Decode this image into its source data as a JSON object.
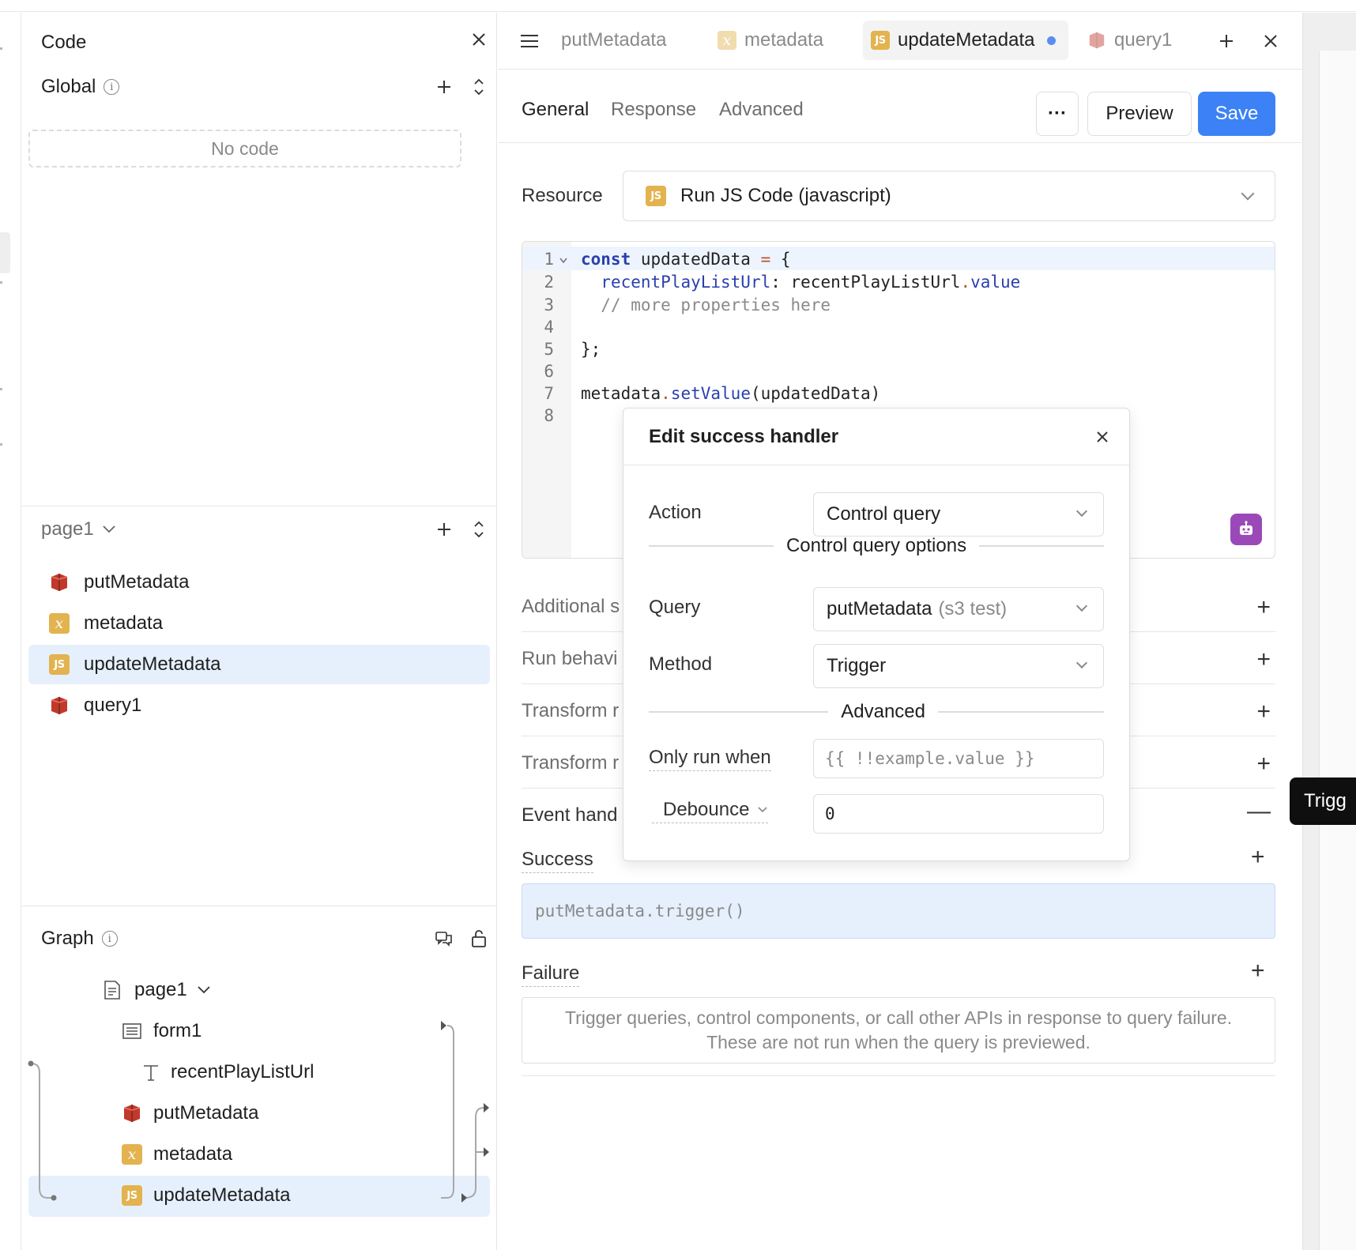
{
  "code_panel": {
    "title": "Code",
    "global": {
      "label": "Global",
      "empty_text": "No code"
    },
    "page": {
      "label": "page1",
      "items": [
        {
          "label": "putMetadata",
          "icon": "s3-icon"
        },
        {
          "label": "metadata",
          "icon": "variable-icon"
        },
        {
          "label": "updateMetadata",
          "icon": "js-icon",
          "selected": true
        },
        {
          "label": "query1",
          "icon": "s3-icon"
        }
      ]
    },
    "graph": {
      "label": "Graph",
      "nodes": [
        {
          "label": "page1",
          "icon": "page-icon"
        },
        {
          "label": "form1",
          "icon": "form-icon"
        },
        {
          "label": "recentPlayListUrl",
          "icon": "text-input-icon"
        },
        {
          "label": "putMetadata",
          "icon": "s3-icon"
        },
        {
          "label": "metadata",
          "icon": "variable-icon"
        },
        {
          "label": "updateMetadata",
          "icon": "js-icon",
          "selected": true
        }
      ]
    }
  },
  "editor": {
    "tabs": [
      {
        "label": "putMetadata",
        "icon": "s3-icon"
      },
      {
        "label": "metadata",
        "icon": "variable-icon"
      },
      {
        "label": "updateMetadata",
        "icon": "js-icon",
        "active": true,
        "unsaved": true
      },
      {
        "label": "query1",
        "icon": "s3-icon"
      }
    ],
    "subtabs": {
      "general": "General",
      "response": "Response",
      "advanced": "Advanced"
    },
    "actions": {
      "more": "···",
      "preview": "Preview",
      "save": "Save"
    },
    "resource": {
      "label": "Resource",
      "value": "Run JS Code (javascript)",
      "icon_text": "JS"
    },
    "code": {
      "line_numbers": [
        "1",
        "2",
        "3",
        "4",
        "5",
        "6",
        "7",
        "8"
      ]
    },
    "sections": {
      "additional": "Additional s",
      "run_behavior": "Run behavi",
      "transform1": "Transform r",
      "transform2": "Transform r",
      "event_handlers": "Event hand"
    },
    "success": {
      "label": "Success",
      "handler": "putMetadata.trigger()"
    },
    "failure": {
      "label": "Failure",
      "placeholder": "Trigger queries, control components, or call other APIs in response to query failure. These are not run when the query is previewed."
    }
  },
  "popover": {
    "title": "Edit success handler",
    "action_label": "Action",
    "action_value": "Control query",
    "options_heading": "Control query options",
    "query_label": "Query",
    "query_value": "putMetadata",
    "query_resource": "(s3 test)",
    "method_label": "Method",
    "method_value": "Trigger",
    "advanced_heading": "Advanced",
    "only_run_label": "Only run when",
    "only_run_placeholder": "{{ !!example.value }}",
    "debounce_label": "Debounce",
    "debounce_value": "0"
  },
  "tooltip": {
    "text": "Trigg"
  },
  "colors": {
    "accent": "#3c82f6",
    "selected_bg": "#e6f0fd",
    "js_icon": "#e2b34e",
    "s3_icon": "#c0392b",
    "ai_button": "#9b49b8"
  }
}
